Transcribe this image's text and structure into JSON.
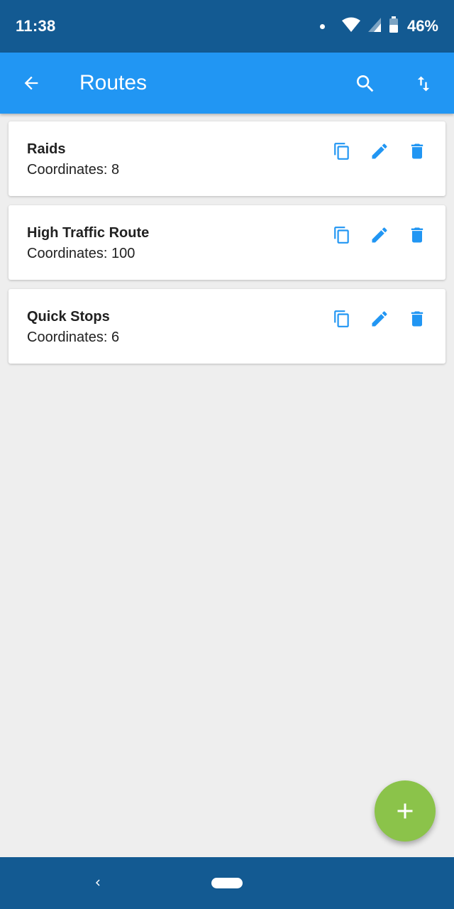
{
  "status": {
    "time": "11:38",
    "battery": "46%",
    "icons": [
      "notification-dot-icon",
      "wifi-icon",
      "cell-signal-icon",
      "battery-icon"
    ]
  },
  "appbar": {
    "title": "Routes",
    "icons": [
      "back-arrow-icon",
      "search-icon",
      "sort-icon"
    ]
  },
  "routes": [
    {
      "name": "Raids",
      "coords": "Coordinates: 8"
    },
    {
      "name": "High Traffic Route",
      "coords": "Coordinates: 100"
    },
    {
      "name": "Quick Stops",
      "coords": "Coordinates: 6"
    }
  ],
  "route_actions": [
    "copy-icon",
    "edit-icon",
    "delete-icon"
  ],
  "fab": {
    "icon": "plus-icon"
  },
  "colors": {
    "statusbar": "#135a92",
    "appbar": "#2196f3",
    "accent": "#2196f3",
    "fab": "#8bc34a",
    "background": "#eeeeee"
  }
}
